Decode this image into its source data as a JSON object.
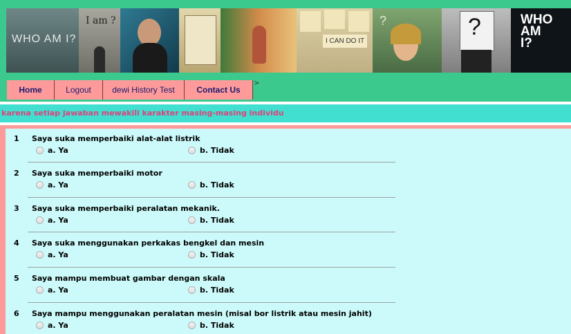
{
  "banner": {
    "panels": [
      {
        "name": "who-am-i-panel-1",
        "caption": "WHO AM I?",
        "color": "#556b6b"
      },
      {
        "name": "i-am-panel",
        "caption": "I am ?",
        "color": "#8b8b84"
      },
      {
        "name": "thinking-man-panel",
        "caption": "",
        "color": "#1e5a70"
      },
      {
        "name": "notes-panel",
        "caption": "",
        "color": "#c9b98a"
      },
      {
        "name": "autumn-girl-panel",
        "caption": "",
        "color": "#c77a4a"
      },
      {
        "name": "motivation-panel",
        "caption": "I CAN DO IT",
        "color": "#d8c89a"
      },
      {
        "name": "girl-question-panel",
        "caption": "?",
        "color": "#6a8f5a"
      },
      {
        "name": "question-sign-panel",
        "caption": "?",
        "color": "#9a9a9a"
      },
      {
        "name": "who-am-i-panel-2",
        "caption": "WHO AM I?",
        "color": "#0f1418"
      }
    ]
  },
  "nav": {
    "items": [
      {
        "label": "Home",
        "bold": true
      },
      {
        "label": "Logout",
        "bold": false
      },
      {
        "label": "dewi History Test",
        "bold": false
      },
      {
        "label": "Contact Us",
        "bold": true
      }
    ],
    "arrow": ">"
  },
  "marquee": {
    "text": "karena setiap jawaban mewakili karakter masing-masing individu"
  },
  "options": {
    "a": "a. Ya",
    "b": "b. Tidak"
  },
  "questions": [
    {
      "num": "1",
      "text": "Saya suka memperbaiki alat-alat listrik"
    },
    {
      "num": "2",
      "text": "Saya suka memperbaiki motor"
    },
    {
      "num": "3",
      "text": "Saya suka memperbaiki peralatan mekanik."
    },
    {
      "num": "4",
      "text": "Saya suka menggunakan perkakas bengkel dan mesin"
    },
    {
      "num": "5",
      "text": "Saya mampu membuat gambar dengan skala"
    },
    {
      "num": "6",
      "text": "Saya mampu menggunakan peralatan mesin (misal bor listrik atau mesin jahit)"
    }
  ],
  "colors": {
    "banner": "#3cc98e",
    "nav_item": "#ff9a9a",
    "marquee_bg": "#40dfd0",
    "marquee_text": "#e0407a",
    "content_bg": "#ccfafa"
  }
}
